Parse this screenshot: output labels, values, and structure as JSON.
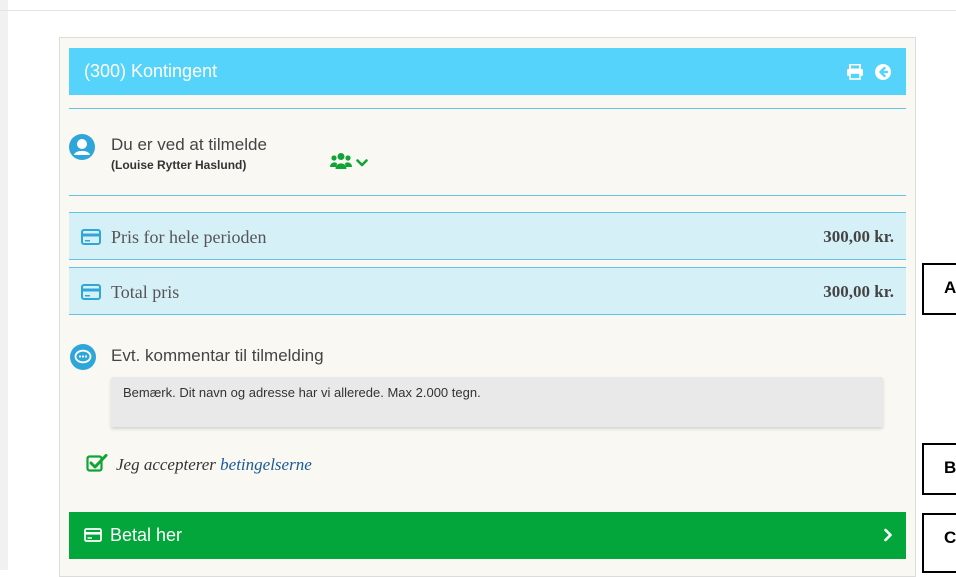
{
  "header": {
    "title": "(300) Kontingent",
    "print_icon": "print-icon",
    "back_icon": "circle-arrow-left-icon"
  },
  "enrollment": {
    "label": "Du er ved at tilmelde",
    "person_name": "(Louise Rytter Haslund)",
    "person_icon": "user-circle-icon",
    "group_icon": "users-icon",
    "toggle_icon": "chevron-down-icon"
  },
  "prices": [
    {
      "label": "Pris for hele perioden",
      "value": "300,00 kr.",
      "icon": "credit-card-icon"
    },
    {
      "label": "Total pris",
      "value": "300,00 kr.",
      "icon": "credit-card-icon"
    }
  ],
  "comment": {
    "label": "Evt. kommentar til tilmelding",
    "placeholder": "Bemærk. Dit navn og adresse har vi allerede. Max 2.000 tegn.",
    "value": "",
    "icon": "comment-icon"
  },
  "terms": {
    "prefix": "Jeg accepterer",
    "link_text": "betingelserne",
    "checked": true
  },
  "pay": {
    "label": "Betal her",
    "icon": "credit-card-icon",
    "chevron_icon": "chevron-right-icon"
  },
  "markers": [
    "A",
    "B",
    "C"
  ],
  "colors": {
    "header_bg": "#55d3fa",
    "row_bg": "#d6f0f8",
    "accent_blue": "#2fa6da",
    "pay_green": "#03a63b",
    "group_green": "#10a436",
    "link": "#1d5a96"
  }
}
